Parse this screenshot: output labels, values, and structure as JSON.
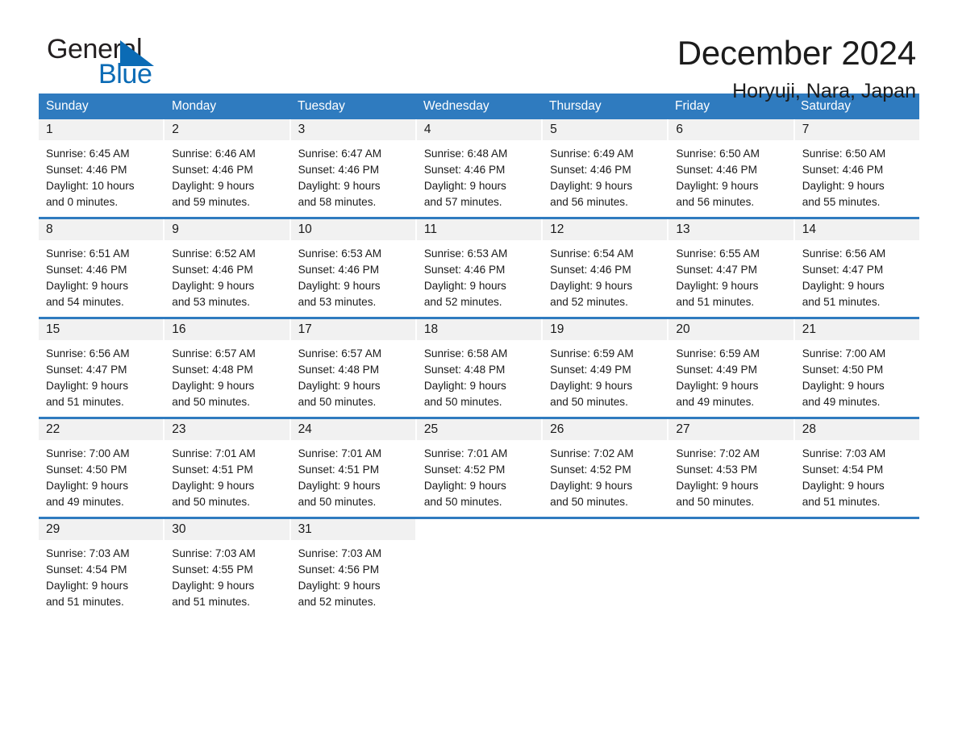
{
  "brand": {
    "name_part1": "General",
    "name_part2": "Blue",
    "triangle_icon": "triangle-logo-icon",
    "accent_color": "#0b6bb5"
  },
  "header": {
    "title": "December 2024",
    "subtitle": "Horyuji, Nara, Japan"
  },
  "colors": {
    "header_blue": "#2f7bbf",
    "day_band_gray": "#f1f1f1",
    "text": "#1a1a1a"
  },
  "weekdays": [
    "Sunday",
    "Monday",
    "Tuesday",
    "Wednesday",
    "Thursday",
    "Friday",
    "Saturday"
  ],
  "weeks": [
    [
      {
        "day": "1",
        "sunrise": "Sunrise: 6:45 AM",
        "sunset": "Sunset: 4:46 PM",
        "daylight_1": "Daylight: 10 hours",
        "daylight_2": "and 0 minutes."
      },
      {
        "day": "2",
        "sunrise": "Sunrise: 6:46 AM",
        "sunset": "Sunset: 4:46 PM",
        "daylight_1": "Daylight: 9 hours",
        "daylight_2": "and 59 minutes."
      },
      {
        "day": "3",
        "sunrise": "Sunrise: 6:47 AM",
        "sunset": "Sunset: 4:46 PM",
        "daylight_1": "Daylight: 9 hours",
        "daylight_2": "and 58 minutes."
      },
      {
        "day": "4",
        "sunrise": "Sunrise: 6:48 AM",
        "sunset": "Sunset: 4:46 PM",
        "daylight_1": "Daylight: 9 hours",
        "daylight_2": "and 57 minutes."
      },
      {
        "day": "5",
        "sunrise": "Sunrise: 6:49 AM",
        "sunset": "Sunset: 4:46 PM",
        "daylight_1": "Daylight: 9 hours",
        "daylight_2": "and 56 minutes."
      },
      {
        "day": "6",
        "sunrise": "Sunrise: 6:50 AM",
        "sunset": "Sunset: 4:46 PM",
        "daylight_1": "Daylight: 9 hours",
        "daylight_2": "and 56 minutes."
      },
      {
        "day": "7",
        "sunrise": "Sunrise: 6:50 AM",
        "sunset": "Sunset: 4:46 PM",
        "daylight_1": "Daylight: 9 hours",
        "daylight_2": "and 55 minutes."
      }
    ],
    [
      {
        "day": "8",
        "sunrise": "Sunrise: 6:51 AM",
        "sunset": "Sunset: 4:46 PM",
        "daylight_1": "Daylight: 9 hours",
        "daylight_2": "and 54 minutes."
      },
      {
        "day": "9",
        "sunrise": "Sunrise: 6:52 AM",
        "sunset": "Sunset: 4:46 PM",
        "daylight_1": "Daylight: 9 hours",
        "daylight_2": "and 53 minutes."
      },
      {
        "day": "10",
        "sunrise": "Sunrise: 6:53 AM",
        "sunset": "Sunset: 4:46 PM",
        "daylight_1": "Daylight: 9 hours",
        "daylight_2": "and 53 minutes."
      },
      {
        "day": "11",
        "sunrise": "Sunrise: 6:53 AM",
        "sunset": "Sunset: 4:46 PM",
        "daylight_1": "Daylight: 9 hours",
        "daylight_2": "and 52 minutes."
      },
      {
        "day": "12",
        "sunrise": "Sunrise: 6:54 AM",
        "sunset": "Sunset: 4:46 PM",
        "daylight_1": "Daylight: 9 hours",
        "daylight_2": "and 52 minutes."
      },
      {
        "day": "13",
        "sunrise": "Sunrise: 6:55 AM",
        "sunset": "Sunset: 4:47 PM",
        "daylight_1": "Daylight: 9 hours",
        "daylight_2": "and 51 minutes."
      },
      {
        "day": "14",
        "sunrise": "Sunrise: 6:56 AM",
        "sunset": "Sunset: 4:47 PM",
        "daylight_1": "Daylight: 9 hours",
        "daylight_2": "and 51 minutes."
      }
    ],
    [
      {
        "day": "15",
        "sunrise": "Sunrise: 6:56 AM",
        "sunset": "Sunset: 4:47 PM",
        "daylight_1": "Daylight: 9 hours",
        "daylight_2": "and 51 minutes."
      },
      {
        "day": "16",
        "sunrise": "Sunrise: 6:57 AM",
        "sunset": "Sunset: 4:48 PM",
        "daylight_1": "Daylight: 9 hours",
        "daylight_2": "and 50 minutes."
      },
      {
        "day": "17",
        "sunrise": "Sunrise: 6:57 AM",
        "sunset": "Sunset: 4:48 PM",
        "daylight_1": "Daylight: 9 hours",
        "daylight_2": "and 50 minutes."
      },
      {
        "day": "18",
        "sunrise": "Sunrise: 6:58 AM",
        "sunset": "Sunset: 4:48 PM",
        "daylight_1": "Daylight: 9 hours",
        "daylight_2": "and 50 minutes."
      },
      {
        "day": "19",
        "sunrise": "Sunrise: 6:59 AM",
        "sunset": "Sunset: 4:49 PM",
        "daylight_1": "Daylight: 9 hours",
        "daylight_2": "and 50 minutes."
      },
      {
        "day": "20",
        "sunrise": "Sunrise: 6:59 AM",
        "sunset": "Sunset: 4:49 PM",
        "daylight_1": "Daylight: 9 hours",
        "daylight_2": "and 49 minutes."
      },
      {
        "day": "21",
        "sunrise": "Sunrise: 7:00 AM",
        "sunset": "Sunset: 4:50 PM",
        "daylight_1": "Daylight: 9 hours",
        "daylight_2": "and 49 minutes."
      }
    ],
    [
      {
        "day": "22",
        "sunrise": "Sunrise: 7:00 AM",
        "sunset": "Sunset: 4:50 PM",
        "daylight_1": "Daylight: 9 hours",
        "daylight_2": "and 49 minutes."
      },
      {
        "day": "23",
        "sunrise": "Sunrise: 7:01 AM",
        "sunset": "Sunset: 4:51 PM",
        "daylight_1": "Daylight: 9 hours",
        "daylight_2": "and 50 minutes."
      },
      {
        "day": "24",
        "sunrise": "Sunrise: 7:01 AM",
        "sunset": "Sunset: 4:51 PM",
        "daylight_1": "Daylight: 9 hours",
        "daylight_2": "and 50 minutes."
      },
      {
        "day": "25",
        "sunrise": "Sunrise: 7:01 AM",
        "sunset": "Sunset: 4:52 PM",
        "daylight_1": "Daylight: 9 hours",
        "daylight_2": "and 50 minutes."
      },
      {
        "day": "26",
        "sunrise": "Sunrise: 7:02 AM",
        "sunset": "Sunset: 4:52 PM",
        "daylight_1": "Daylight: 9 hours",
        "daylight_2": "and 50 minutes."
      },
      {
        "day": "27",
        "sunrise": "Sunrise: 7:02 AM",
        "sunset": "Sunset: 4:53 PM",
        "daylight_1": "Daylight: 9 hours",
        "daylight_2": "and 50 minutes."
      },
      {
        "day": "28",
        "sunrise": "Sunrise: 7:03 AM",
        "sunset": "Sunset: 4:54 PM",
        "daylight_1": "Daylight: 9 hours",
        "daylight_2": "and 51 minutes."
      }
    ],
    [
      {
        "day": "29",
        "sunrise": "Sunrise: 7:03 AM",
        "sunset": "Sunset: 4:54 PM",
        "daylight_1": "Daylight: 9 hours",
        "daylight_2": "and 51 minutes."
      },
      {
        "day": "30",
        "sunrise": "Sunrise: 7:03 AM",
        "sunset": "Sunset: 4:55 PM",
        "daylight_1": "Daylight: 9 hours",
        "daylight_2": "and 51 minutes."
      },
      {
        "day": "31",
        "sunrise": "Sunrise: 7:03 AM",
        "sunset": "Sunset: 4:56 PM",
        "daylight_1": "Daylight: 9 hours",
        "daylight_2": "and 52 minutes."
      },
      {
        "day": "",
        "sunrise": "",
        "sunset": "",
        "daylight_1": "",
        "daylight_2": ""
      },
      {
        "day": "",
        "sunrise": "",
        "sunset": "",
        "daylight_1": "",
        "daylight_2": ""
      },
      {
        "day": "",
        "sunrise": "",
        "sunset": "",
        "daylight_1": "",
        "daylight_2": ""
      },
      {
        "day": "",
        "sunrise": "",
        "sunset": "",
        "daylight_1": "",
        "daylight_2": ""
      }
    ]
  ]
}
